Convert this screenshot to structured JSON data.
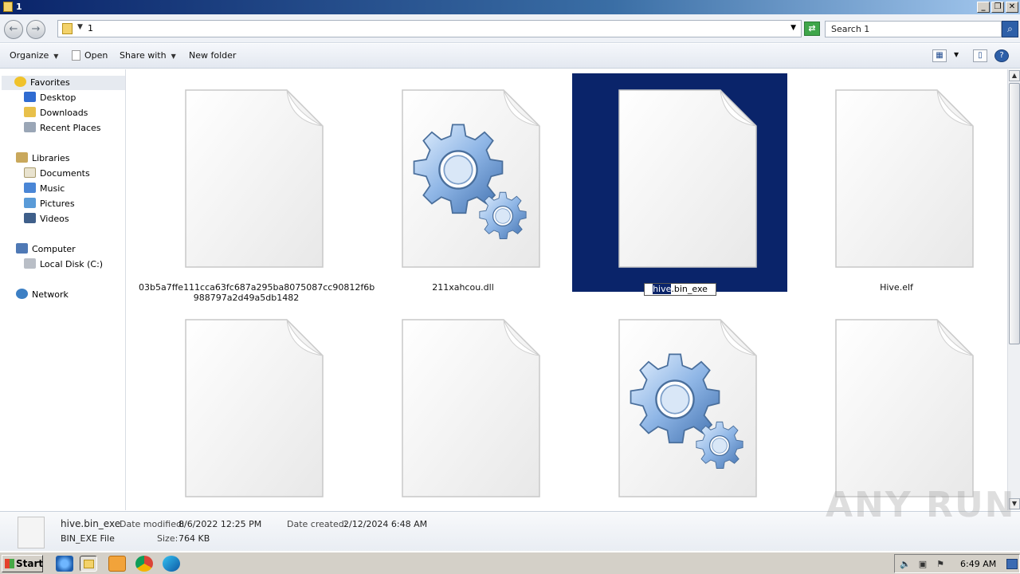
{
  "window": {
    "title": "1"
  },
  "address": {
    "crumb": "1",
    "search_placeholder": "Search 1"
  },
  "toolbar": {
    "organize": "Organize",
    "open": "Open",
    "share_with": "Share with",
    "new_folder": "New folder"
  },
  "nav": {
    "favorites": "Favorites",
    "desktop": "Desktop",
    "downloads": "Downloads",
    "recent_places": "Recent Places",
    "libraries": "Libraries",
    "documents": "Documents",
    "music": "Music",
    "pictures": "Pictures",
    "videos": "Videos",
    "computer": "Computer",
    "local_disk": "Local Disk (C:)",
    "network": "Network"
  },
  "files": [
    {
      "name": "03b5a7ffe111cca63fc687a295ba8075087cc90812f6b988797a2d49a5db1482",
      "line1": "03b5a7ffe111cca63fc687a295ba8075087cc90812f6b",
      "line2": "988797a2d49a5db1482",
      "icon": "blank-document-icon"
    },
    {
      "name": "211xahcou.dll",
      "icon": "gears-document-icon"
    },
    {
      "name_sel": "hive",
      "name_rest": ".bin_exe",
      "icon": "blank-document-icon",
      "selected": true,
      "renaming": true
    },
    {
      "name": "Hive.elf",
      "icon": "blank-document-icon"
    },
    {
      "name": "",
      "icon": "blank-document-icon"
    },
    {
      "name": "",
      "icon": "blank-document-icon"
    },
    {
      "name": "",
      "icon": "gears-document-icon"
    },
    {
      "name": "",
      "icon": "blank-document-icon"
    }
  ],
  "details": {
    "name": "hive.bin_exe",
    "type": "BIN_EXE File",
    "date_modified_label": "Date modified:",
    "date_modified": "8/6/2022 12:25 PM",
    "date_created_label": "Date created:",
    "date_created": "2/12/2024 6:48 AM",
    "size_label": "Size:",
    "size": "764 KB"
  },
  "watermark": "ANY RUN",
  "taskbar": {
    "start": "Start",
    "clock": "6:49 AM"
  },
  "colors": {
    "selection": "#0a246a",
    "titlebar": "#0a246a",
    "taskbar": "#d4d0c8"
  }
}
